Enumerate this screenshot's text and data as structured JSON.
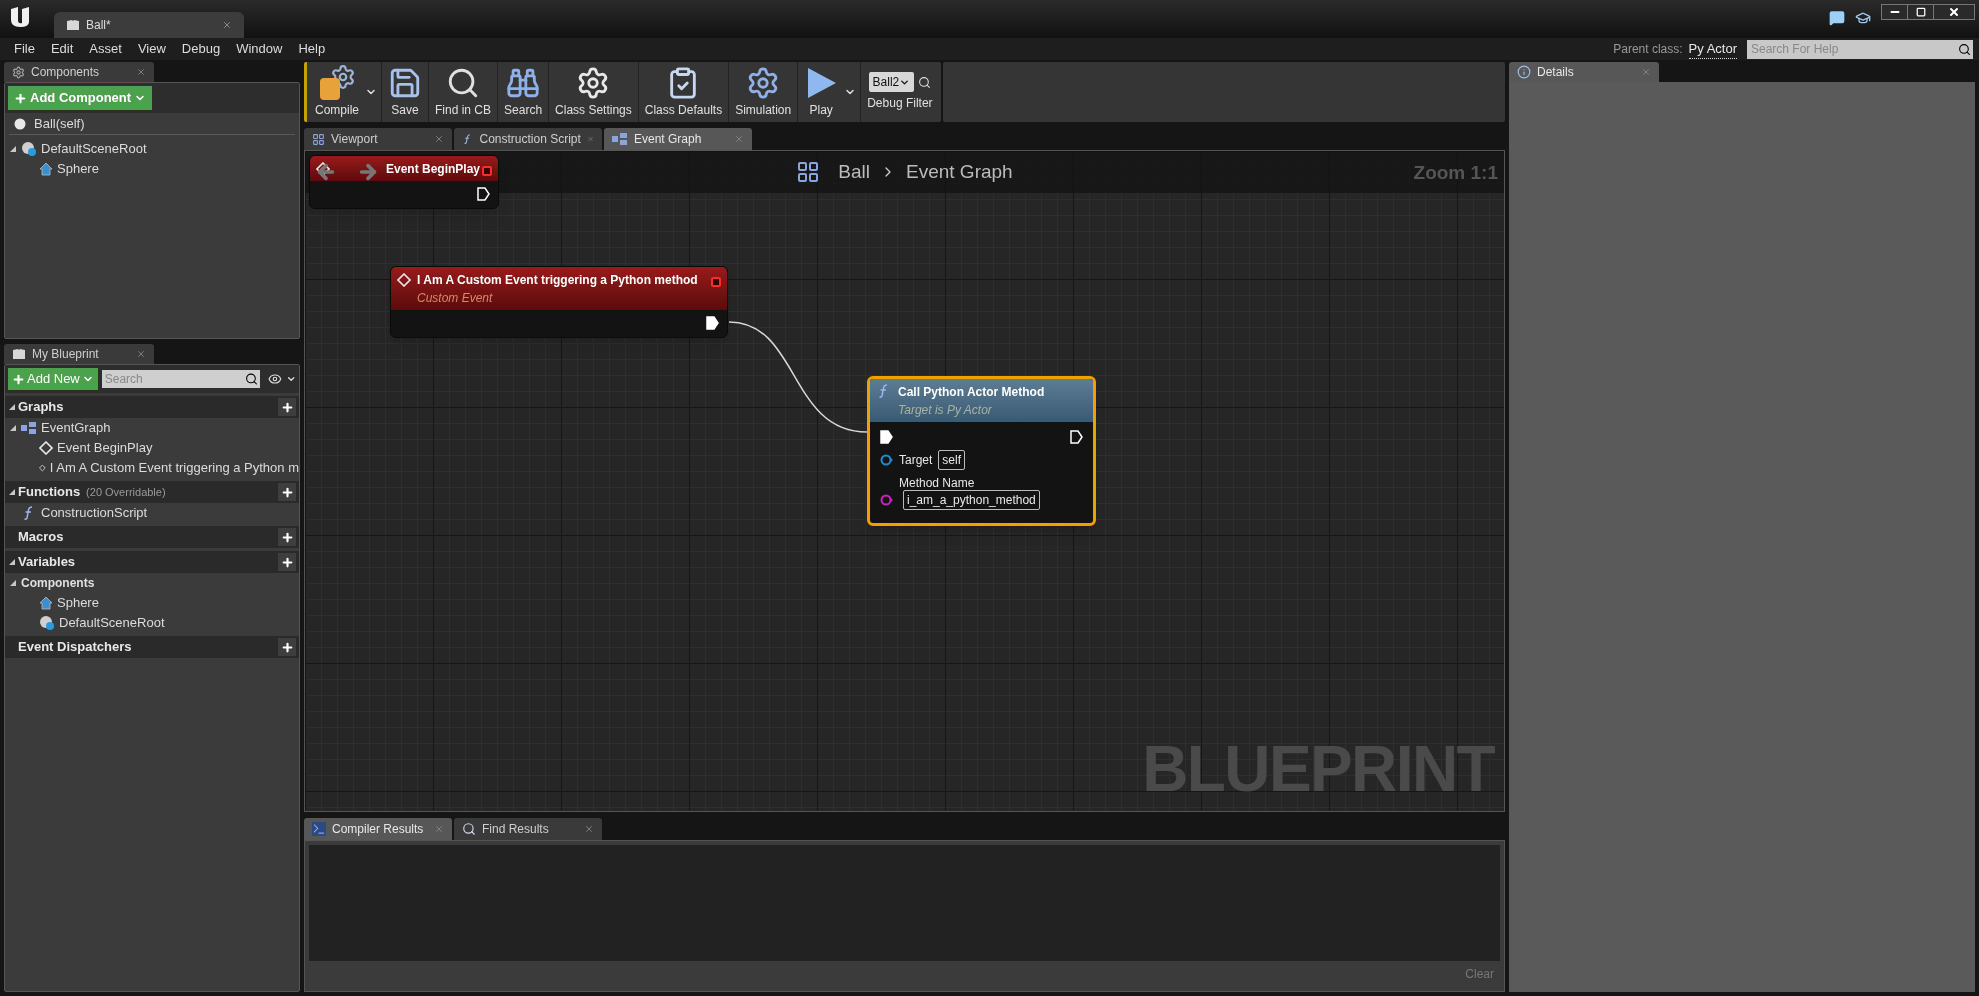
{
  "window": {
    "tab": "Ball*"
  },
  "menu": [
    "File",
    "Edit",
    "Asset",
    "View",
    "Debug",
    "Window",
    "Help"
  ],
  "parent_class": {
    "label": "Parent class:",
    "value": "Py Actor"
  },
  "help_search": {
    "placeholder": "Search For Help"
  },
  "components_panel": {
    "tab": "Components",
    "add_button": "Add Component",
    "self_item": "Ball(self)",
    "tree": [
      {
        "label": "DefaultSceneRoot",
        "kind": "root",
        "children": [
          {
            "label": "Sphere",
            "kind": "mesh"
          }
        ]
      }
    ]
  },
  "my_blueprint": {
    "tab": "My Blueprint",
    "add_button": "Add New",
    "search": {
      "placeholder": "Search"
    },
    "sections": [
      {
        "title": "Graphs",
        "items": [
          {
            "label": "EventGraph",
            "kind": "graph",
            "children": [
              {
                "label": "Event BeginPlay",
                "kind": "event"
              },
              {
                "label": "I Am A Custom Event triggering a Python m",
                "kind": "event"
              }
            ]
          }
        ]
      },
      {
        "title": "Functions",
        "note": "(20 Overridable)",
        "items": [
          {
            "label": "ConstructionScript",
            "kind": "function"
          }
        ]
      },
      {
        "title": "Macros"
      },
      {
        "title": "Variables",
        "items": [
          {
            "label": "Components",
            "kind": "category",
            "children": [
              {
                "label": "Sphere",
                "kind": "mesh"
              },
              {
                "label": "DefaultSceneRoot",
                "kind": "root"
              }
            ]
          }
        ]
      },
      {
        "title": "Event Dispatchers"
      }
    ]
  },
  "toolbar": [
    {
      "label": "Compile",
      "kind": "compile",
      "dropdown": true
    },
    {
      "label": "Save",
      "kind": "save",
      "dropdown": false
    },
    {
      "label": "Find in CB",
      "kind": "find",
      "dropdown": false
    },
    {
      "label": "Search",
      "kind": "search",
      "dropdown": false
    },
    {
      "label": "Class Settings",
      "kind": "settings",
      "dropdown": false
    },
    {
      "label": "Class Defaults",
      "kind": "defaults",
      "dropdown": false
    },
    {
      "label": "Simulation",
      "kind": "simulation",
      "dropdown": false
    },
    {
      "label": "Play",
      "kind": "play",
      "dropdown": true
    }
  ],
  "debug_filter": {
    "value": "Ball2",
    "label": "Debug Filter"
  },
  "doc_tabs": [
    {
      "label": "Viewport",
      "kind": "viewport",
      "selected": false
    },
    {
      "label": "Construction Script",
      "kind": "function",
      "selected": false
    },
    {
      "label": "Event Graph",
      "kind": "graph",
      "selected": true
    }
  ],
  "graph": {
    "breadcrumb": [
      "Ball",
      "Event Graph"
    ],
    "zoom": "Zoom 1:1",
    "watermark": "BLUEPRINT",
    "nodes": [
      {
        "kind": "event",
        "title": "Event BeginPlay",
        "selected": false
      },
      {
        "kind": "event",
        "title": "I Am A Custom Event triggering a Python method",
        "subtitle": "Custom Event",
        "selected": false
      },
      {
        "kind": "function",
        "title": "Call Python Actor Method",
        "subtitle": "Target is Py Actor",
        "selected": true,
        "pins": [
          {
            "name": "Target",
            "value": "self",
            "color": "#1a8fd6"
          },
          {
            "name": "Method Name",
            "value": "i_am_a_python_method",
            "color": "#d21fc4"
          }
        ]
      }
    ]
  },
  "bottom_tabs": [
    {
      "label": "Compiler Results",
      "kind": "compiler",
      "selected": true
    },
    {
      "label": "Find Results",
      "kind": "find",
      "selected": false
    }
  ],
  "clear_button": "Clear",
  "details": {
    "tab": "Details"
  }
}
